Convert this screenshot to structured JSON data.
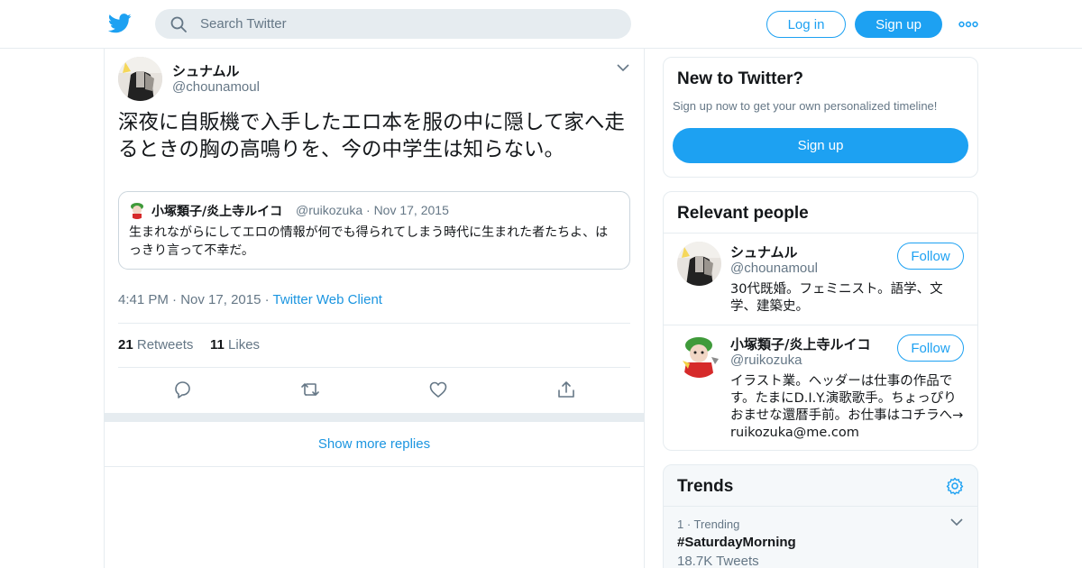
{
  "colors": {
    "brand": "#1da1f2",
    "link": "#1b95e0",
    "muted": "#657786",
    "text": "#14171a",
    "border": "#e6ecf0"
  },
  "header": {
    "logo_icon": "twitter-bird-icon",
    "search_placeholder": "Search Twitter",
    "login_label": "Log in",
    "signup_label": "Sign up",
    "more_icon": "more-dots-icon"
  },
  "tweet": {
    "author_name": "シュナムル",
    "author_handle": "@chounamoul",
    "text": "深夜に自販機で入手したエロ本を服の中に隠して家へ走るときの胸の高鳴りを、今の中学生は知らない。",
    "quote": {
      "author_name": "小塚類子/炎上寺ルイコ",
      "meta": "@ruikozuka · Nov 17, 2015",
      "text": "生まれながらにしてエロの情報が何でも得られてしまう時代に生まれた者たちよ、はっきり言って不幸だ。"
    },
    "time": "4:41 PM",
    "date": "Nov 17, 2015",
    "client": "Twitter Web Client",
    "retweets_count": "21",
    "retweets_label": "Retweets",
    "likes_count": "11",
    "likes_label": "Likes",
    "actions": [
      "reply-icon",
      "retweet-icon",
      "like-icon",
      "share-icon"
    ],
    "show_more_label": "Show more replies"
  },
  "sidebar": {
    "new_to_twitter": {
      "title": "New to Twitter?",
      "subtitle": "Sign up now to get your own personalized timeline!",
      "button_label": "Sign up"
    },
    "relevant_people": {
      "title": "Relevant people",
      "people": [
        {
          "name": "シュナムル",
          "handle": "@chounamoul",
          "bio": "30代既婚。フェミニスト。語学、文学、建築史。",
          "follow_label": "Follow"
        },
        {
          "name": "小塚類子/炎上寺ルイコ",
          "handle": "@ruikozuka",
          "bio": "イラスト業。ヘッダーは仕事の作品です。たまにD.I.Y.演歌歌手。ちょっぴりおませな還暦手前。お仕事はコチラへ→ ruikozuka@me.com",
          "follow_label": "Follow"
        }
      ]
    },
    "trends": {
      "title": "Trends",
      "items": [
        {
          "rank_label": "1 · Trending",
          "name": "#SaturdayMorning",
          "count": "18.7K Tweets"
        }
      ]
    }
  }
}
